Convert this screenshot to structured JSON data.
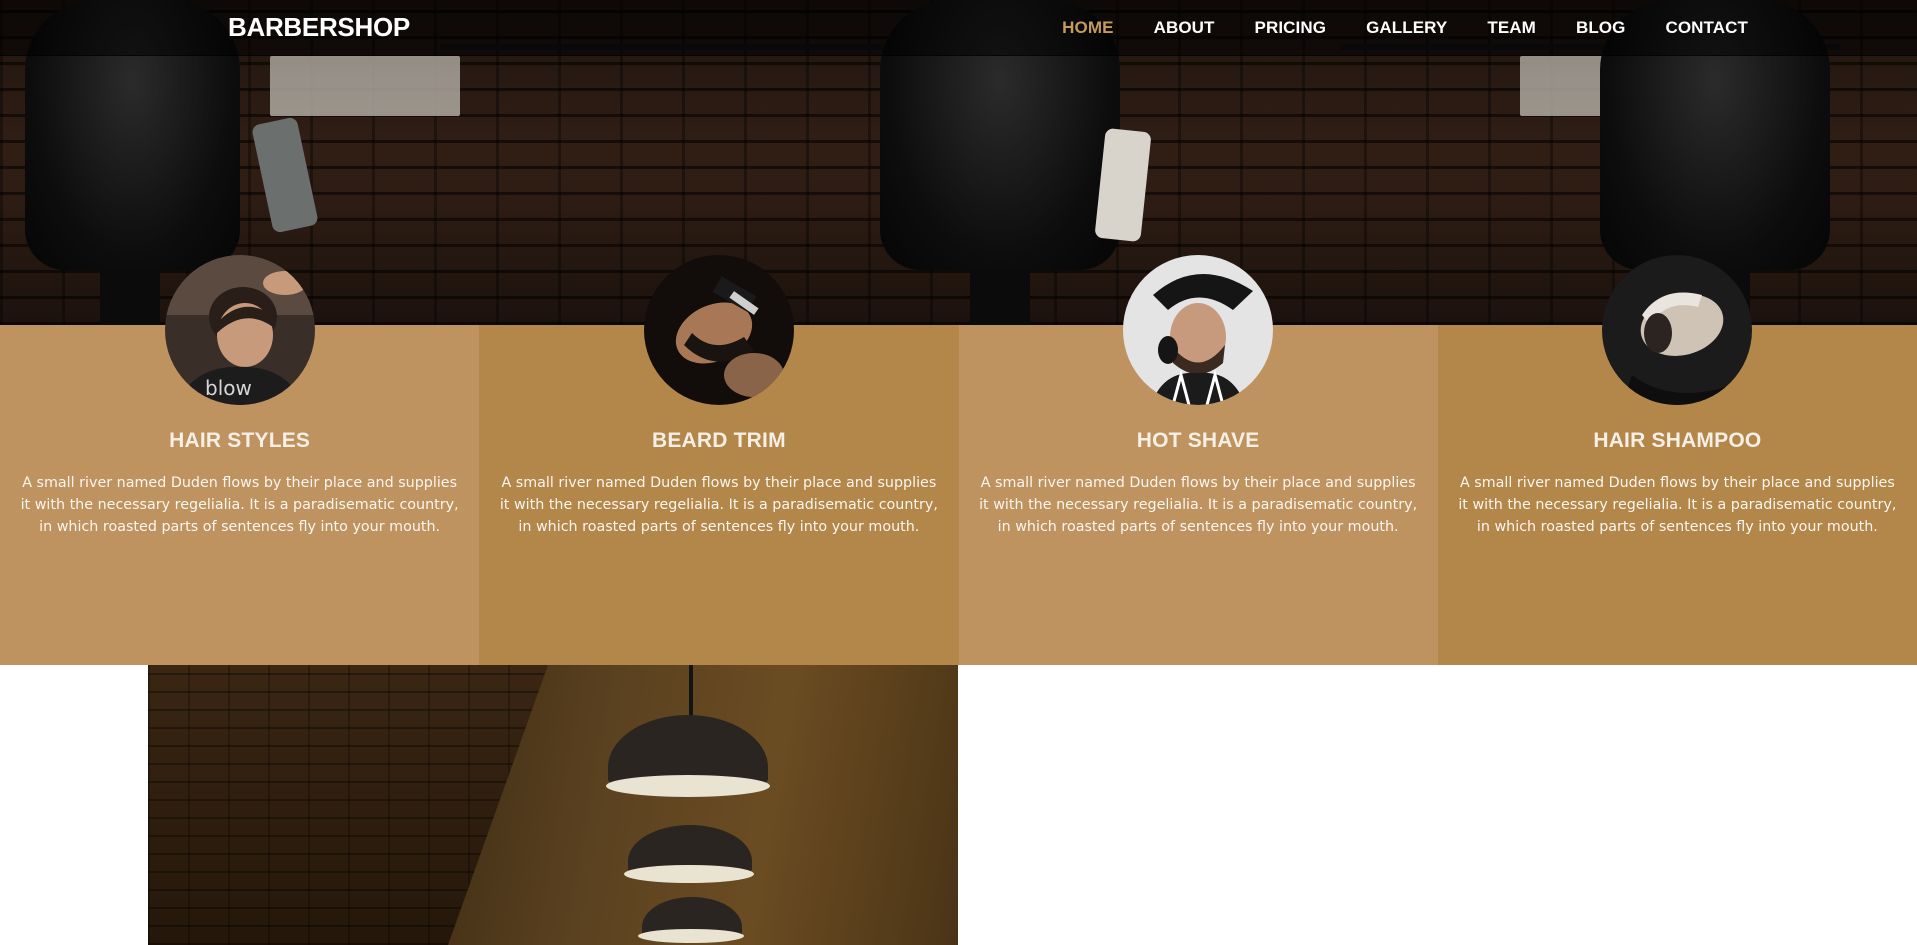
{
  "brand": {
    "name": "BARBERSHOP"
  },
  "nav": {
    "items": [
      {
        "label": "HOME",
        "active": true
      },
      {
        "label": "ABOUT",
        "active": false
      },
      {
        "label": "PRICING",
        "active": false
      },
      {
        "label": "GALLERY",
        "active": false
      },
      {
        "label": "TEAM",
        "active": false
      },
      {
        "label": "BLOG",
        "active": false
      },
      {
        "label": "CONTACT",
        "active": false
      }
    ]
  },
  "services": [
    {
      "title": "HAIR STYLES",
      "description": "A small river named Duden flows by their place and supplies it with the necessary regelialia. It is a paradisematic country, in which roasted parts of sentences fly into your mouth.",
      "image": "man-haircut-photo"
    },
    {
      "title": "BEARD TRIM",
      "description": "A small river named Duden flows by their place and supplies it with the necessary regelialia. It is a paradisematic country, in which roasted parts of sentences fly into your mouth.",
      "image": "beard-trim-photo"
    },
    {
      "title": "HOT SHAVE",
      "description": "A small river named Duden flows by their place and supplies it with the necessary regelialia. It is a paradisematic country, in which roasted parts of sentences fly into your mouth.",
      "image": "hot-shave-photo"
    },
    {
      "title": "HAIR SHAMPOO",
      "description": "A small river named Duden flows by their place and supplies it with the necessary regelialia. It is a paradisematic country, in which roasted parts of sentences fly into your mouth.",
      "image": "hair-shampoo-photo"
    }
  ],
  "colors": {
    "accent": "#c49a5e",
    "service_light": "#bf9360",
    "service_dark": "#b3864a",
    "nav_text": "#ffffff"
  }
}
